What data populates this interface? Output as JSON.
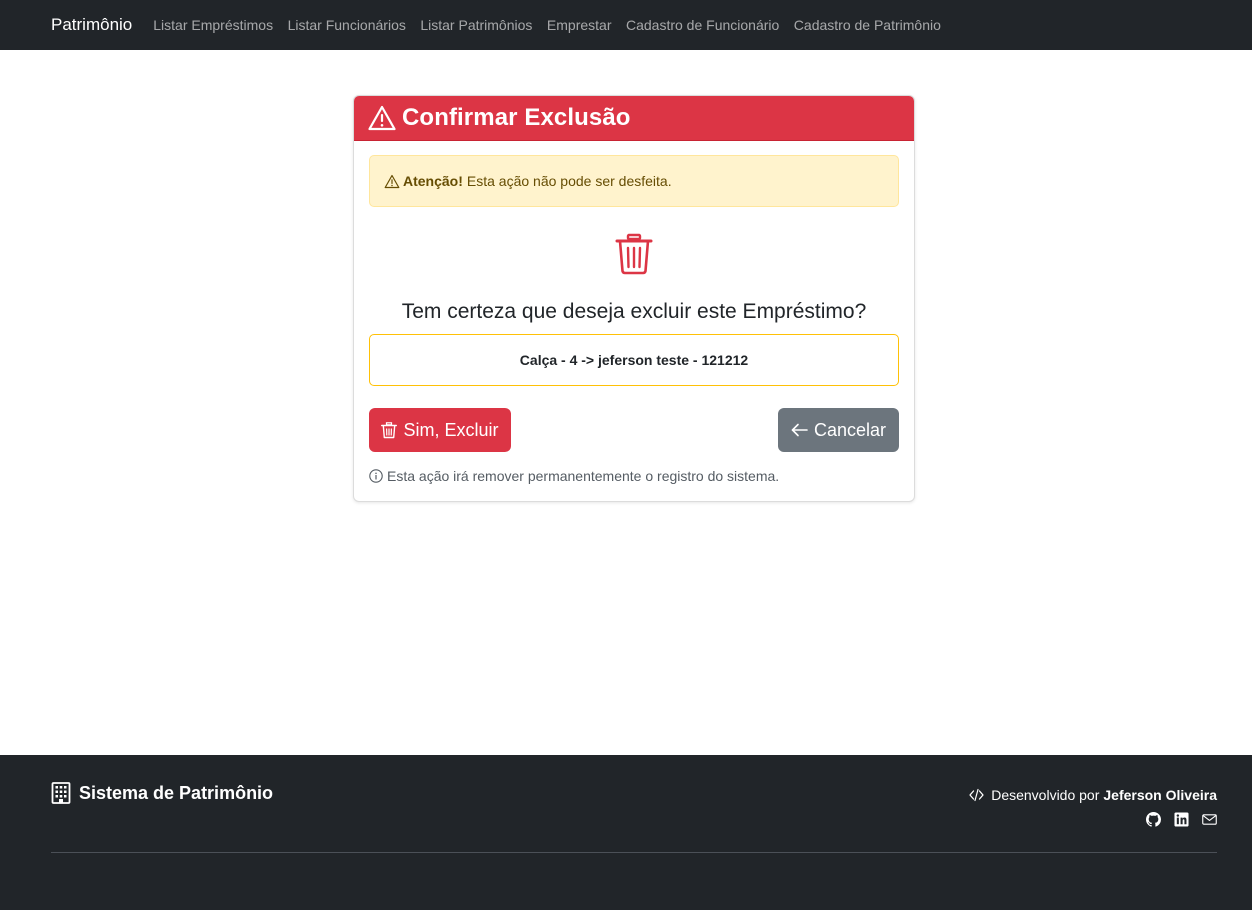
{
  "navbar": {
    "brand": "Patrimônio",
    "links": [
      "Listar Empréstimos",
      "Listar Funcionários",
      "Listar Patrimônios",
      "Emprestar",
      "Cadastro de Funcionário",
      "Cadastro de Patrimônio"
    ]
  },
  "card": {
    "title": "Confirmar Exclusão",
    "alert_strong": "Atenção!",
    "alert_text": "Esta ação não pode ser desfeita.",
    "question": "Tem certeza que deseja excluir este Empréstimo?",
    "record": "Calça - 4 -> jeferson teste - 121212",
    "confirm_button": "Sim, Excluir",
    "cancel_button": "Cancelar",
    "note": "Esta ação irá remover permanentemente o registro do sistema."
  },
  "footer": {
    "brand": "Sistema de Patrimônio",
    "dev_prefix": "Desenvolvido por",
    "dev_name": "Jeferson Oliveira",
    "icons": [
      "github-icon",
      "linkedin-icon",
      "envelope-icon"
    ]
  },
  "colors": {
    "navbar_bg": "#212529",
    "danger": "#dc3545",
    "secondary": "#6c757d",
    "warning_bg": "#fff3cd",
    "warning_border": "#ffc107"
  }
}
